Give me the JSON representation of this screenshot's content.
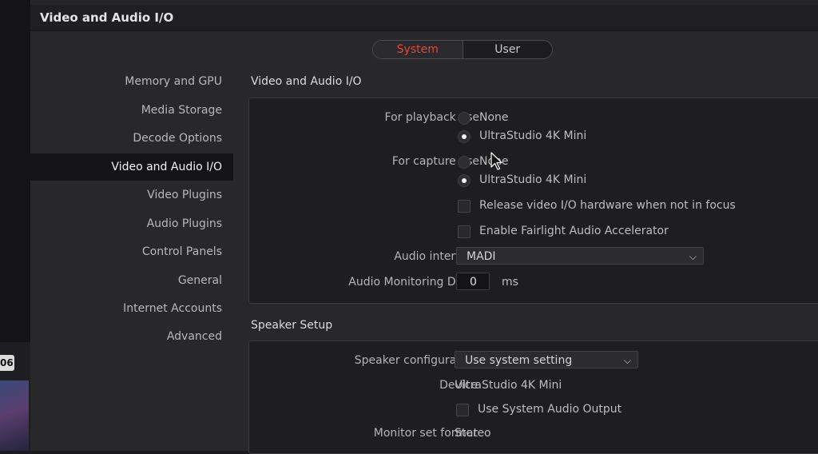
{
  "background": {
    "timecode": "06"
  },
  "dialog": {
    "title": "Video and Audio I/O"
  },
  "tabs": [
    {
      "label": "System",
      "active": true
    },
    {
      "label": "User",
      "active": false
    }
  ],
  "sidebar": {
    "items": [
      {
        "label": "Memory and GPU"
      },
      {
        "label": "Media Storage"
      },
      {
        "label": "Decode Options"
      },
      {
        "label": "Video and Audio I/O",
        "selected": true
      },
      {
        "label": "Video Plugins"
      },
      {
        "label": "Audio Plugins"
      },
      {
        "label": "Control Panels"
      },
      {
        "label": "General"
      },
      {
        "label": "Internet Accounts"
      },
      {
        "label": "Advanced"
      }
    ]
  },
  "io_section": {
    "title": "Video and Audio I/O",
    "playback_label": "For playback use",
    "playback_options": [
      "None",
      "UltraStudio 4K Mini"
    ],
    "playback_selected": "UltraStudio 4K Mini",
    "capture_label": "For capture use",
    "capture_options": [
      "None",
      "UltraStudio 4K Mini"
    ],
    "capture_selected": "UltraStudio 4K Mini",
    "release_label": "Release video I/O hardware when not in focus",
    "release_checked": false,
    "fairlight_label": "Enable Fairlight Audio Accelerator",
    "fairlight_checked": false,
    "audio_interface_label": "Audio interface",
    "audio_interface_value": "MADI",
    "monitoring_delay_label": "Audio Monitoring Delay",
    "monitoring_delay_value": "0",
    "monitoring_delay_unit": "ms"
  },
  "speaker_section": {
    "title": "Speaker Setup",
    "config_label": "Speaker configuration",
    "config_value": "Use system setting",
    "device_label": "Device",
    "device_value": "UltraStudio 4K Mini",
    "system_output_label": "Use System Audio Output",
    "system_output_checked": false,
    "monitor_format_label": "Monitor set format",
    "monitor_format_value": "Stereo"
  },
  "colors": {
    "accent": "#e8453a",
    "panel": "#1e1e20",
    "dialog": "#28282a"
  },
  "icons": [
    "chevron-down-icon",
    "mouse-cursor-icon"
  ]
}
